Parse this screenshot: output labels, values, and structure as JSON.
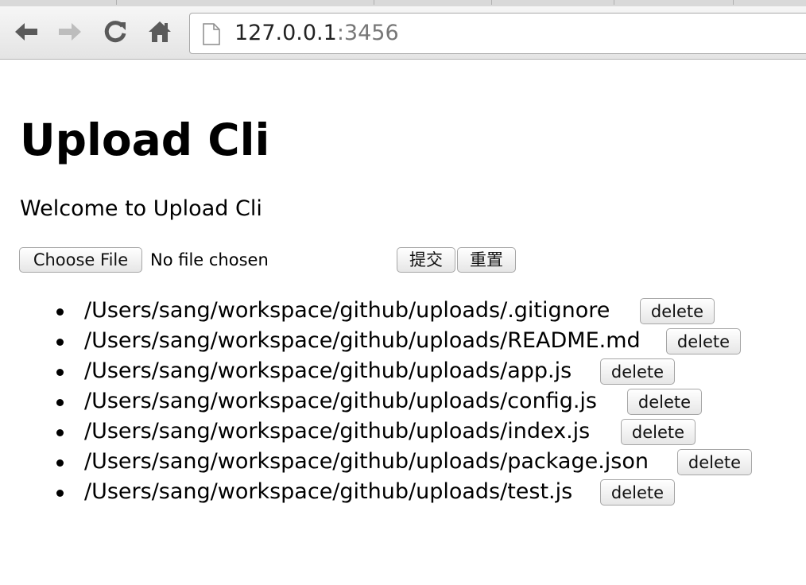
{
  "browser": {
    "url_host": "127.0.0.1",
    "url_port": ":3456"
  },
  "page": {
    "title": "Upload Cli",
    "welcome": "Welcome to Upload Cli",
    "form": {
      "choose_label": "Choose File",
      "no_file_text": "No file chosen",
      "submit_label": "提交",
      "reset_label": "重置"
    },
    "delete_label": "delete",
    "files": [
      "/Users/sang/workspace/github/uploads/.gitignore",
      "/Users/sang/workspace/github/uploads/README.md",
      "/Users/sang/workspace/github/uploads/app.js",
      "/Users/sang/workspace/github/uploads/config.js",
      "/Users/sang/workspace/github/uploads/index.js",
      "/Users/sang/workspace/github/uploads/package.json",
      "/Users/sang/workspace/github/uploads/test.js"
    ]
  }
}
